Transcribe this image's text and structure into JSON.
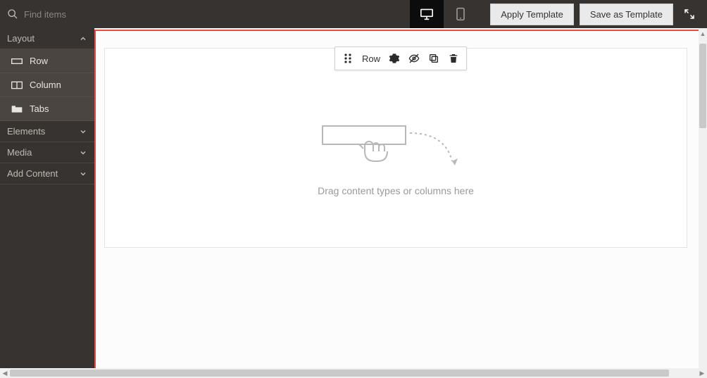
{
  "search": {
    "placeholder": "Find items"
  },
  "toolbar": {
    "applyTemplate": "Apply Template",
    "saveAsTemplate": "Save as Template"
  },
  "sidebar": {
    "sections": {
      "layout": "Layout",
      "elements": "Elements",
      "media": "Media",
      "addContent": "Add Content"
    },
    "layoutItems": {
      "row": "Row",
      "column": "Column",
      "tabs": "Tabs"
    }
  },
  "rowToolbar": {
    "label": "Row"
  },
  "canvas": {
    "dropHint": "Drag content types or columns here"
  }
}
